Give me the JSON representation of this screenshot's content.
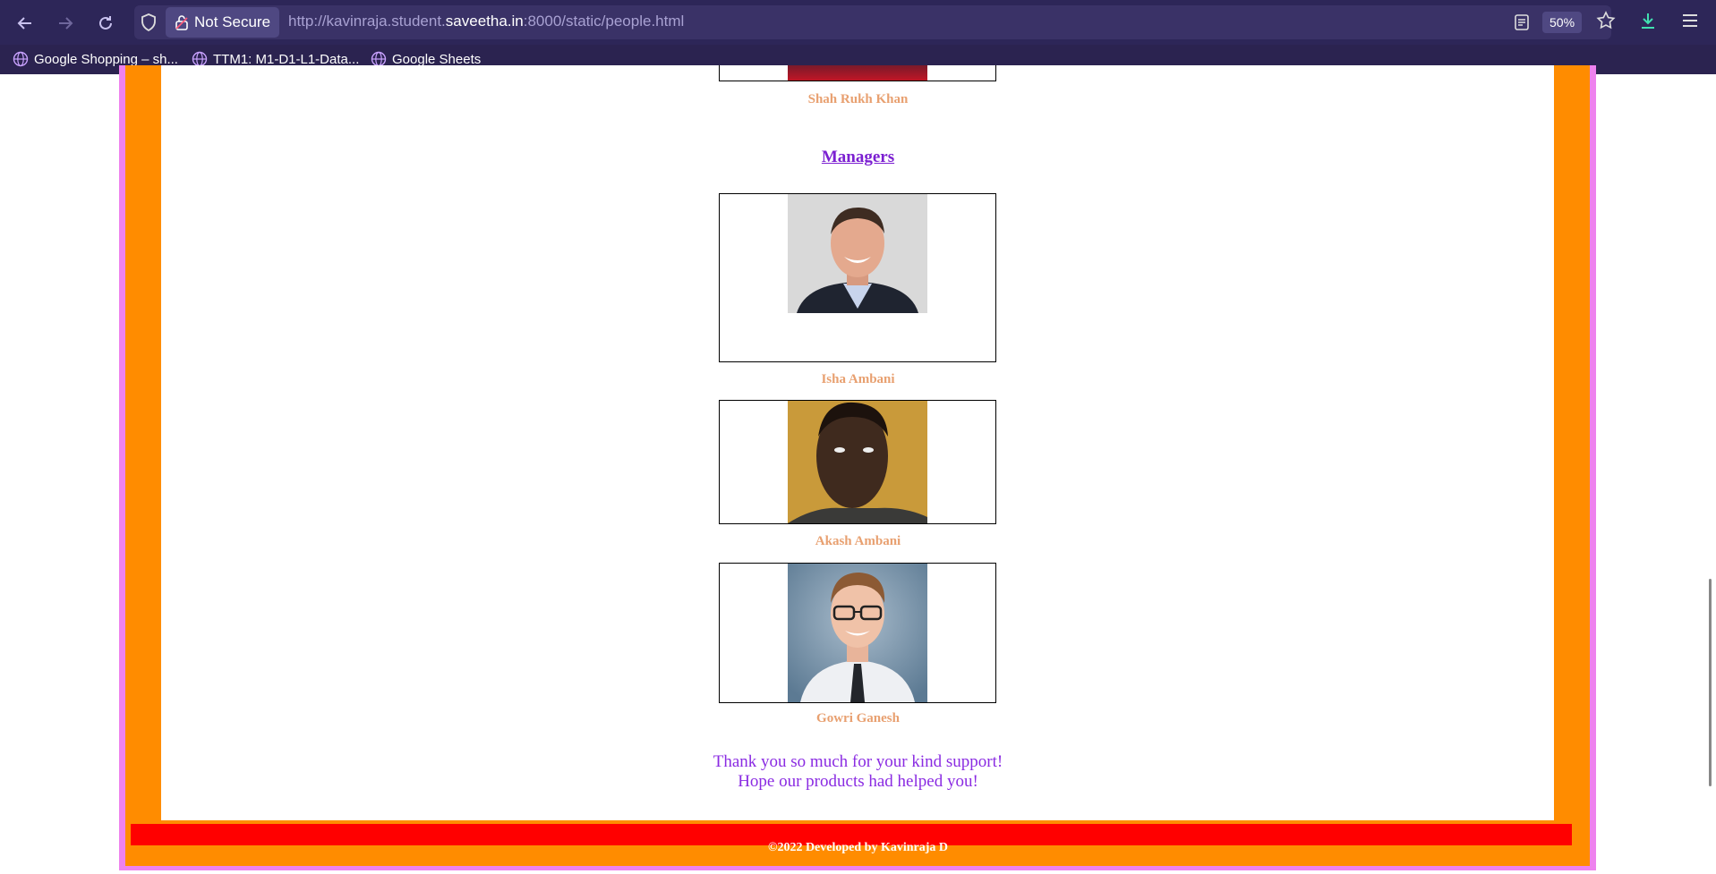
{
  "browser": {
    "security_label": "Not Secure",
    "url_prefix": "http://kavinraja.student.",
    "url_domain": "saveetha.in",
    "url_suffix": ":8000/static/people.html",
    "zoom": "50%",
    "bookmarks": [
      {
        "label": "Google Shopping – sh..."
      },
      {
        "label": "TTM1: M1-D1-L1-Data..."
      },
      {
        "label": "Google Sheets"
      }
    ]
  },
  "page": {
    "top_person": "Shah Rukh Khan",
    "section_heading": "Managers",
    "managers": [
      {
        "name": "Isha Ambani"
      },
      {
        "name": "Akash Ambani"
      },
      {
        "name": "Gowri Ganesh"
      }
    ],
    "thanks_line1": "Thank you so much for your kind support!",
    "thanks_line2": "Hope our products had helped you!",
    "footer": "©2022 Developed by Kavinraja D"
  },
  "colors": {
    "frame_outer": "#ee82ee",
    "frame_inner": "#ff8c00",
    "footer_bar": "#ff0000",
    "name_text": "#e8a070",
    "heading": "#7b1fd1"
  }
}
